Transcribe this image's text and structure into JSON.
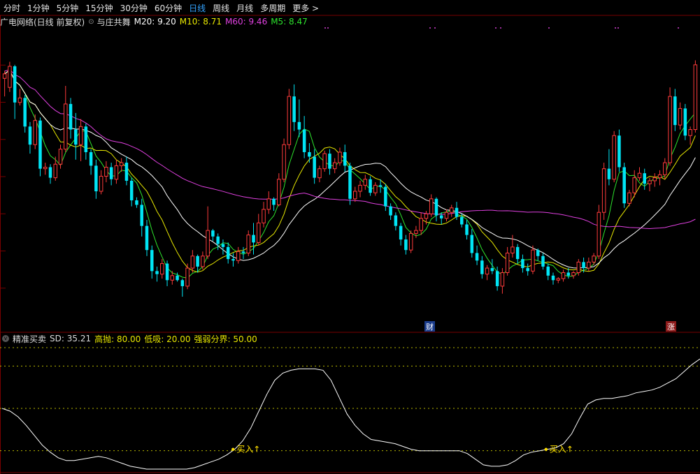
{
  "periods": [
    {
      "label": "分时",
      "active": false
    },
    {
      "label": "1分钟",
      "active": false
    },
    {
      "label": "5分钟",
      "active": false
    },
    {
      "label": "15分钟",
      "active": false
    },
    {
      "label": "30分钟",
      "active": false
    },
    {
      "label": "60分钟",
      "active": false
    },
    {
      "label": "日线",
      "active": true
    },
    {
      "label": "周线",
      "active": false
    },
    {
      "label": "月线",
      "active": false
    },
    {
      "label": "多周期",
      "active": false
    },
    {
      "label": "更多 >",
      "active": false
    }
  ],
  "main_panel": {
    "stock_title": "广电网络(日线 前复权)",
    "indicator_name": "与庄共舞",
    "m20": "M20: 9.20",
    "m10": "M10: 8.71",
    "m60": "M60: 9.46",
    "m5": "M5: 8.47"
  },
  "sub_panel": {
    "name": "精准买卖",
    "sd": "SD: 35.21",
    "high": "高抛: 80.00",
    "low": "低吸: 20.00",
    "divide": "强弱分界: 50.00",
    "buy_label": "买入↑"
  },
  "badges": {
    "cai": "财",
    "zhang": "涨"
  },
  "colors": {
    "up": "#ff3b3b",
    "down": "#00e5f5",
    "m5": "#2de52d",
    "m10": "#e8e800",
    "m20": "#ffffff",
    "m60": "#e040e0",
    "grid": "#7a0000",
    "badge_cai": "#1a3c8c",
    "badge_zhang": "#8c1a1a"
  },
  "chart_data": {
    "type": "candlestick",
    "candles": [
      [
        9.98,
        10.08,
        9.74,
        10.04
      ],
      [
        9.86,
        10.2,
        9.8,
        10.14
      ],
      [
        10.14,
        10.16,
        9.44,
        9.66
      ],
      [
        9.66,
        9.84,
        9.62,
        9.72
      ],
      [
        9.72,
        9.76,
        9.26,
        9.34
      ],
      [
        9.34,
        9.4,
        8.98,
        9.1
      ],
      [
        9.1,
        9.5,
        9.04,
        9.42
      ],
      [
        9.42,
        9.46,
        8.68,
        8.78
      ],
      [
        8.78,
        8.86,
        8.7,
        8.8
      ],
      [
        8.8,
        8.84,
        8.58,
        8.66
      ],
      [
        8.66,
        8.94,
        8.62,
        8.84
      ],
      [
        8.84,
        9.1,
        8.78,
        9.04
      ],
      [
        9.04,
        9.88,
        9.0,
        9.64
      ],
      [
        9.64,
        9.72,
        9.18,
        9.3
      ],
      [
        9.3,
        9.52,
        8.9,
        9.1
      ],
      [
        9.1,
        9.44,
        8.88,
        9.34
      ],
      [
        9.34,
        9.38,
        8.9,
        9.0
      ],
      [
        9.0,
        9.04,
        8.7,
        8.82
      ],
      [
        8.82,
        8.9,
        8.38,
        8.48
      ],
      [
        8.48,
        8.76,
        8.44,
        8.68
      ],
      [
        8.68,
        8.88,
        8.6,
        8.8
      ],
      [
        8.8,
        8.86,
        8.56,
        8.64
      ],
      [
        8.64,
        8.9,
        8.58,
        8.82
      ],
      [
        8.82,
        8.92,
        8.74,
        8.86
      ],
      [
        8.86,
        8.94,
        8.56,
        8.62
      ],
      [
        8.62,
        8.66,
        8.28,
        8.36
      ],
      [
        8.36,
        8.4,
        8.26,
        8.3
      ],
      [
        8.3,
        8.38,
        7.88,
        8.02
      ],
      [
        8.02,
        8.1,
        7.62,
        7.7
      ],
      [
        7.7,
        7.76,
        7.32,
        7.42
      ],
      [
        7.42,
        7.48,
        7.28,
        7.38
      ],
      [
        7.38,
        7.58,
        7.32,
        7.52
      ],
      [
        7.52,
        7.56,
        7.22,
        7.3
      ],
      [
        7.3,
        7.42,
        7.24,
        7.36
      ],
      [
        7.36,
        7.4,
        7.28,
        7.3
      ],
      [
        7.3,
        7.32,
        7.08,
        7.22
      ],
      [
        7.22,
        7.52,
        7.18,
        7.46
      ],
      [
        7.46,
        7.7,
        7.4,
        7.62
      ],
      [
        7.62,
        7.64,
        7.4,
        7.48
      ],
      [
        7.48,
        7.68,
        7.44,
        7.62
      ],
      [
        7.62,
        8.28,
        7.58,
        7.96
      ],
      [
        7.96,
        7.98,
        7.82,
        7.88
      ],
      [
        7.88,
        7.92,
        7.7,
        7.78
      ],
      [
        7.78,
        7.84,
        7.64,
        7.74
      ],
      [
        7.74,
        7.8,
        7.52,
        7.58
      ],
      [
        7.58,
        7.66,
        7.48,
        7.56
      ],
      [
        7.56,
        7.74,
        7.52,
        7.68
      ],
      [
        7.68,
        7.74,
        7.58,
        7.66
      ],
      [
        7.66,
        7.96,
        7.62,
        7.9
      ],
      [
        7.9,
        8.06,
        7.64,
        7.8
      ],
      [
        7.8,
        8.18,
        7.76,
        8.06
      ],
      [
        8.06,
        8.34,
        8.0,
        8.24
      ],
      [
        8.24,
        8.48,
        8.18,
        8.38
      ],
      [
        8.38,
        8.4,
        8.22,
        8.3
      ],
      [
        8.3,
        8.72,
        8.28,
        8.64
      ],
      [
        8.64,
        9.18,
        8.6,
        9.1
      ],
      [
        9.1,
        9.84,
        9.04,
        9.74
      ],
      [
        9.74,
        9.9,
        9.28,
        9.4
      ],
      [
        9.4,
        9.7,
        9.2,
        9.3
      ],
      [
        9.3,
        9.48,
        8.92,
        9.0
      ],
      [
        9.0,
        9.12,
        8.86,
        8.94
      ],
      [
        8.94,
        9.04,
        8.58,
        8.66
      ],
      [
        8.66,
        8.82,
        8.6,
        8.78
      ],
      [
        8.78,
        9.02,
        8.74,
        8.98
      ],
      [
        8.98,
        9.04,
        8.7,
        8.78
      ],
      [
        8.78,
        8.92,
        8.72,
        8.86
      ],
      [
        8.86,
        9.06,
        8.82,
        9.0
      ],
      [
        9.0,
        9.1,
        8.74,
        8.82
      ],
      [
        8.82,
        8.86,
        8.3,
        8.38
      ],
      [
        8.38,
        8.54,
        8.34,
        8.48
      ],
      [
        8.48,
        8.62,
        8.4,
        8.56
      ],
      [
        8.56,
        8.7,
        8.5,
        8.64
      ],
      [
        8.64,
        8.68,
        8.42,
        8.46
      ],
      [
        8.46,
        8.6,
        8.42,
        8.56
      ],
      [
        8.56,
        8.64,
        8.46,
        8.54
      ],
      [
        8.54,
        8.58,
        8.22,
        8.28
      ],
      [
        8.28,
        8.32,
        8.1,
        8.16
      ],
      [
        8.16,
        8.2,
        7.96,
        8.02
      ],
      [
        8.02,
        8.06,
        7.76,
        7.84
      ],
      [
        7.84,
        7.9,
        7.64,
        7.7
      ],
      [
        7.7,
        7.96,
        7.66,
        7.92
      ],
      [
        7.92,
        8.02,
        7.86,
        7.96
      ],
      [
        7.96,
        8.2,
        7.9,
        8.12
      ],
      [
        8.12,
        8.22,
        8.04,
        8.18
      ],
      [
        8.18,
        8.44,
        8.14,
        8.38
      ],
      [
        8.38,
        8.4,
        8.08,
        8.16
      ],
      [
        8.16,
        8.2,
        8.04,
        8.12
      ],
      [
        8.12,
        8.24,
        8.08,
        8.2
      ],
      [
        8.2,
        8.3,
        8.14,
        8.26
      ],
      [
        8.26,
        8.34,
        8.1,
        8.14
      ],
      [
        8.14,
        8.18,
        8.0,
        8.04
      ],
      [
        8.04,
        8.1,
        7.84,
        7.9
      ],
      [
        7.9,
        7.98,
        7.6,
        7.66
      ],
      [
        7.66,
        7.76,
        7.5,
        7.56
      ],
      [
        7.56,
        7.62,
        7.32,
        7.38
      ],
      [
        7.38,
        7.5,
        7.3,
        7.46
      ],
      [
        7.46,
        7.58,
        7.38,
        7.42
      ],
      [
        7.42,
        7.48,
        7.16,
        7.22
      ],
      [
        7.22,
        7.46,
        7.12,
        7.4
      ],
      [
        7.4,
        7.74,
        7.36,
        7.66
      ],
      [
        7.66,
        7.9,
        7.6,
        7.74
      ],
      [
        7.74,
        7.78,
        7.52,
        7.58
      ],
      [
        7.58,
        7.64,
        7.4,
        7.46
      ],
      [
        7.46,
        7.52,
        7.36,
        7.42
      ],
      [
        7.42,
        7.76,
        7.38,
        7.7
      ],
      [
        7.7,
        7.72,
        7.56,
        7.62
      ],
      [
        7.62,
        7.66,
        7.44,
        7.48
      ],
      [
        7.48,
        7.52,
        7.3,
        7.36
      ],
      [
        7.36,
        7.4,
        7.24,
        7.3
      ],
      [
        7.3,
        7.34,
        7.26,
        7.32
      ],
      [
        7.32,
        7.44,
        7.28,
        7.4
      ],
      [
        7.4,
        7.46,
        7.32,
        7.36
      ],
      [
        7.36,
        7.42,
        7.32,
        7.4
      ],
      [
        7.4,
        7.58,
        7.36,
        7.54
      ],
      [
        7.54,
        7.6,
        7.4,
        7.46
      ],
      [
        7.46,
        7.6,
        7.42,
        7.54
      ],
      [
        7.54,
        7.66,
        7.5,
        7.62
      ],
      [
        7.62,
        8.3,
        7.58,
        8.2
      ],
      [
        8.2,
        8.86,
        8.1,
        8.78
      ],
      [
        8.78,
        9.04,
        8.56,
        8.64
      ],
      [
        8.64,
        9.28,
        8.6,
        9.22
      ],
      [
        9.22,
        9.3,
        8.74,
        8.8
      ],
      [
        8.8,
        8.86,
        8.26,
        8.32
      ],
      [
        8.32,
        8.5,
        8.28,
        8.46
      ],
      [
        8.46,
        8.76,
        8.4,
        8.66
      ],
      [
        8.66,
        8.8,
        8.62,
        8.72
      ],
      [
        8.72,
        8.78,
        8.5,
        8.58
      ],
      [
        8.58,
        8.66,
        8.48,
        8.62
      ],
      [
        8.62,
        8.72,
        8.54,
        8.66
      ],
      [
        8.66,
        8.76,
        8.56,
        8.7
      ],
      [
        8.7,
        8.92,
        8.64,
        8.86
      ],
      [
        8.86,
        9.86,
        8.82,
        9.74
      ],
      [
        9.74,
        9.84,
        9.28,
        9.36
      ],
      [
        9.36,
        9.66,
        9.3,
        9.58
      ],
      [
        9.58,
        9.64,
        9.16,
        9.22
      ],
      [
        9.22,
        9.34,
        9.1,
        9.3
      ],
      [
        9.3,
        10.22,
        9.26,
        10.16
      ]
    ],
    "ma_periods": [
      5,
      10,
      20,
      60
    ],
    "price_range": [
      6.7,
      10.65
    ],
    "oscillator": {
      "name": "精准买卖",
      "value": 35.21,
      "upper": 80,
      "lower": 20,
      "middle": 50,
      "range": [
        5,
        95
      ],
      "series": [
        50,
        48,
        44,
        38,
        31,
        24,
        19,
        15,
        13,
        13,
        14,
        15,
        16,
        15,
        13,
        11,
        9,
        8,
        7,
        7,
        7,
        7,
        7,
        7,
        8,
        10,
        12,
        14,
        17,
        21,
        27,
        36,
        48,
        60,
        70,
        75,
        77,
        78,
        78,
        78,
        77,
        70,
        58,
        46,
        38,
        32,
        28,
        27,
        26,
        25,
        23,
        21,
        20,
        20,
        20,
        20,
        20,
        20,
        18,
        14,
        10,
        9,
        9,
        10,
        13,
        17,
        19,
        20,
        21,
        22,
        25,
        32,
        43,
        53,
        56,
        57,
        57,
        58,
        59,
        61,
        62,
        63,
        65,
        68,
        71,
        76,
        81,
        85
      ]
    },
    "buy_signals": [
      {
        "index": 45,
        "label": "买入↑"
      },
      {
        "index": 106,
        "label": "买入↑"
      }
    ]
  }
}
